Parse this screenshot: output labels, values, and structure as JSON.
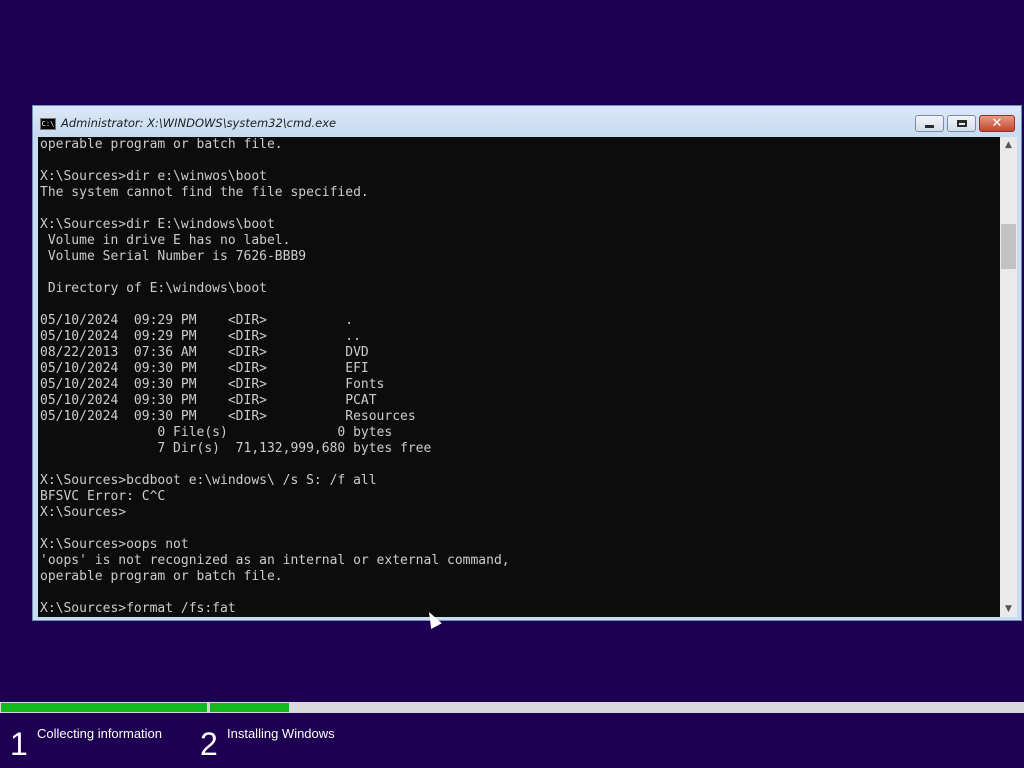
{
  "window": {
    "title": "Administrator: X:\\WINDOWS\\system32\\cmd.exe",
    "icon_text": "C:\\",
    "buttons": {
      "minimize": "minimize-icon",
      "maximize": "maximize-icon",
      "close": "✕"
    }
  },
  "console": {
    "lines": [
      "operable program or batch file.",
      "",
      "X:\\Sources>dir e:\\winwos\\boot",
      "The system cannot find the file specified.",
      "",
      "X:\\Sources>dir E:\\windows\\boot",
      " Volume in drive E has no label.",
      " Volume Serial Number is 7626-BBB9",
      "",
      " Directory of E:\\windows\\boot",
      "",
      "05/10/2024  09:29 PM    <DIR>          .",
      "05/10/2024  09:29 PM    <DIR>          ..",
      "08/22/2013  07:36 AM    <DIR>          DVD",
      "05/10/2024  09:30 PM    <DIR>          EFI",
      "05/10/2024  09:30 PM    <DIR>          Fonts",
      "05/10/2024  09:30 PM    <DIR>          PCAT",
      "05/10/2024  09:30 PM    <DIR>          Resources",
      "               0 File(s)              0 bytes",
      "               7 Dir(s)  71,132,999,680 bytes free",
      "",
      "X:\\Sources>bcdboot e:\\windows\\ /s S: /f all",
      "BFSVC Error: C^C",
      "X:\\Sources>",
      "",
      "X:\\Sources>oops not",
      "'oops' is not recognized as an internal or external command,",
      "operable program or batch file.",
      "",
      "X:\\Sources>format /fs:fat"
    ]
  },
  "setup": {
    "progress": {
      "step1_fraction": 1.0,
      "step2_fraction": 0.097
    },
    "steps": [
      {
        "number": "1",
        "label": "Collecting information"
      },
      {
        "number": "2",
        "label": "Installing Windows"
      }
    ],
    "colors": {
      "background": "#1e0052",
      "progress_fill": "#12b91c",
      "progress_track": "#d9d9d9"
    }
  }
}
